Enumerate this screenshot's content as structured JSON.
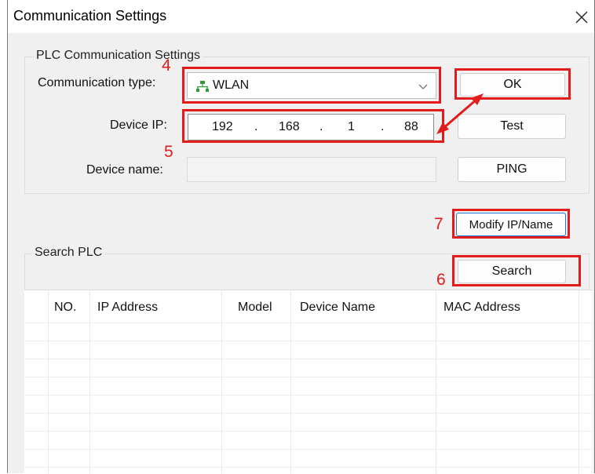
{
  "window": {
    "title": "Communication Settings"
  },
  "plc_settings": {
    "group_title": "PLC Communication Settings",
    "comm_type_label": "Communication type:",
    "comm_type_value": "WLAN",
    "device_ip_label": "Device IP:",
    "ip": [
      "192",
      "168",
      "1",
      "88"
    ],
    "ip_separator": ".",
    "device_name_label": "Device name:",
    "device_name_value": ""
  },
  "buttons": {
    "ok": "OK",
    "test": "Test",
    "ping": "PING",
    "modify": "Modify IP/Name",
    "search": "Search"
  },
  "search_plc": {
    "group_title": "Search PLC",
    "columns": [
      "NO.",
      "IP Address",
      "Model",
      "Device Name",
      "MAC Address"
    ],
    "rows": []
  },
  "annotations": {
    "a4": "4",
    "a5": "5",
    "a6": "6",
    "a7": "7"
  },
  "colors": {
    "highlight": "#e41b1b",
    "background": "#f0f0f0",
    "network_icon": "#2e9a3a"
  },
  "icons": {
    "close": "close-icon",
    "network": "network-icon",
    "dropdown": "chevron-down-icon"
  }
}
